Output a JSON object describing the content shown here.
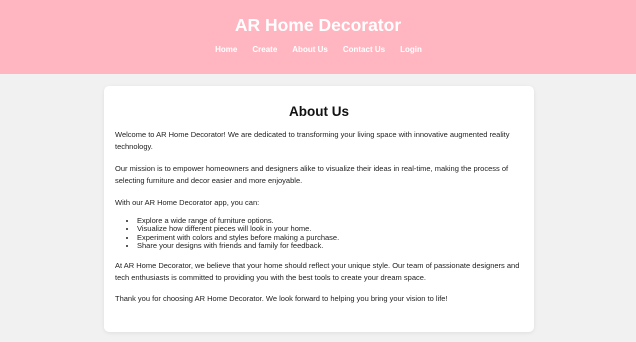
{
  "header": {
    "title": "AR Home Decorator",
    "nav": [
      {
        "label": "Home"
      },
      {
        "label": "Create"
      },
      {
        "label": "About Us"
      },
      {
        "label": "Contact Us"
      },
      {
        "label": "Login"
      }
    ]
  },
  "colors": {
    "header_bg": "#ffb6c1",
    "page_bg": "#f1f1f1",
    "card_bg": "#ffffff"
  },
  "main": {
    "heading": "About Us",
    "paragraphs": [
      "Welcome to AR Home Decorator! We are dedicated to transforming your living space with innovative augmented reality technology.",
      "Our mission is to empower homeowners and designers alike to visualize their ideas in real-time, making the process of selecting furniture and decor easier and more enjoyable.",
      "With our AR Home Decorator app, you can:",
      "At AR Home Decorator, we believe that your home should reflect your unique style. Our team of passionate designers and tech enthusiasts is committed to providing you with the best tools to create your dream space.",
      "Thank you for choosing AR Home Decorator. We look forward to helping you bring your vision to life!"
    ],
    "features": [
      "Explore a wide range of furniture options.",
      "Visualize how different pieces will look in your home.",
      "Experiment with colors and styles before making a purchase.",
      "Share your designs with friends and family for feedback."
    ]
  }
}
